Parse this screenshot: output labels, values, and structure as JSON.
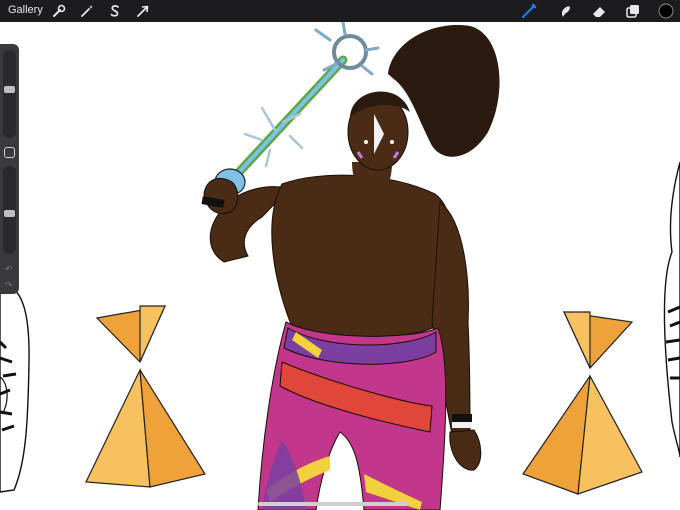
{
  "toolbar": {
    "gallery_label": "Gallery",
    "left_tools": [
      "wrench-icon",
      "magic-wand-icon",
      "selection-s-icon",
      "transform-arrow-icon"
    ],
    "right_tools": [
      "brush-icon",
      "smudge-icon",
      "eraser-icon",
      "layers-icon",
      "color-swatch-icon"
    ],
    "active_tool": "brush",
    "accent_color": "#1f7cf2",
    "current_color": "#000000"
  },
  "sidebar": {
    "brush_size": 0.55,
    "brush_opacity": 0.45,
    "controls": [
      "size-slider",
      "modify-button",
      "opacity-slider",
      "undo-button",
      "redo-button"
    ]
  },
  "canvas": {
    "background": "#ffffff",
    "palette": {
      "skin": "#4a2c16",
      "hair": "#2a1a10",
      "pants_magenta": "#c2378b",
      "sash_purple": "#7a3fa0",
      "sash_red": "#e0463a",
      "stripe_yellow": "#f2d23c",
      "pyramid_orange": "#f0a23a",
      "pyramid_light": "#f7c160",
      "staff_blue": "#7fc0e6",
      "staff_green": "#5da845"
    }
  }
}
